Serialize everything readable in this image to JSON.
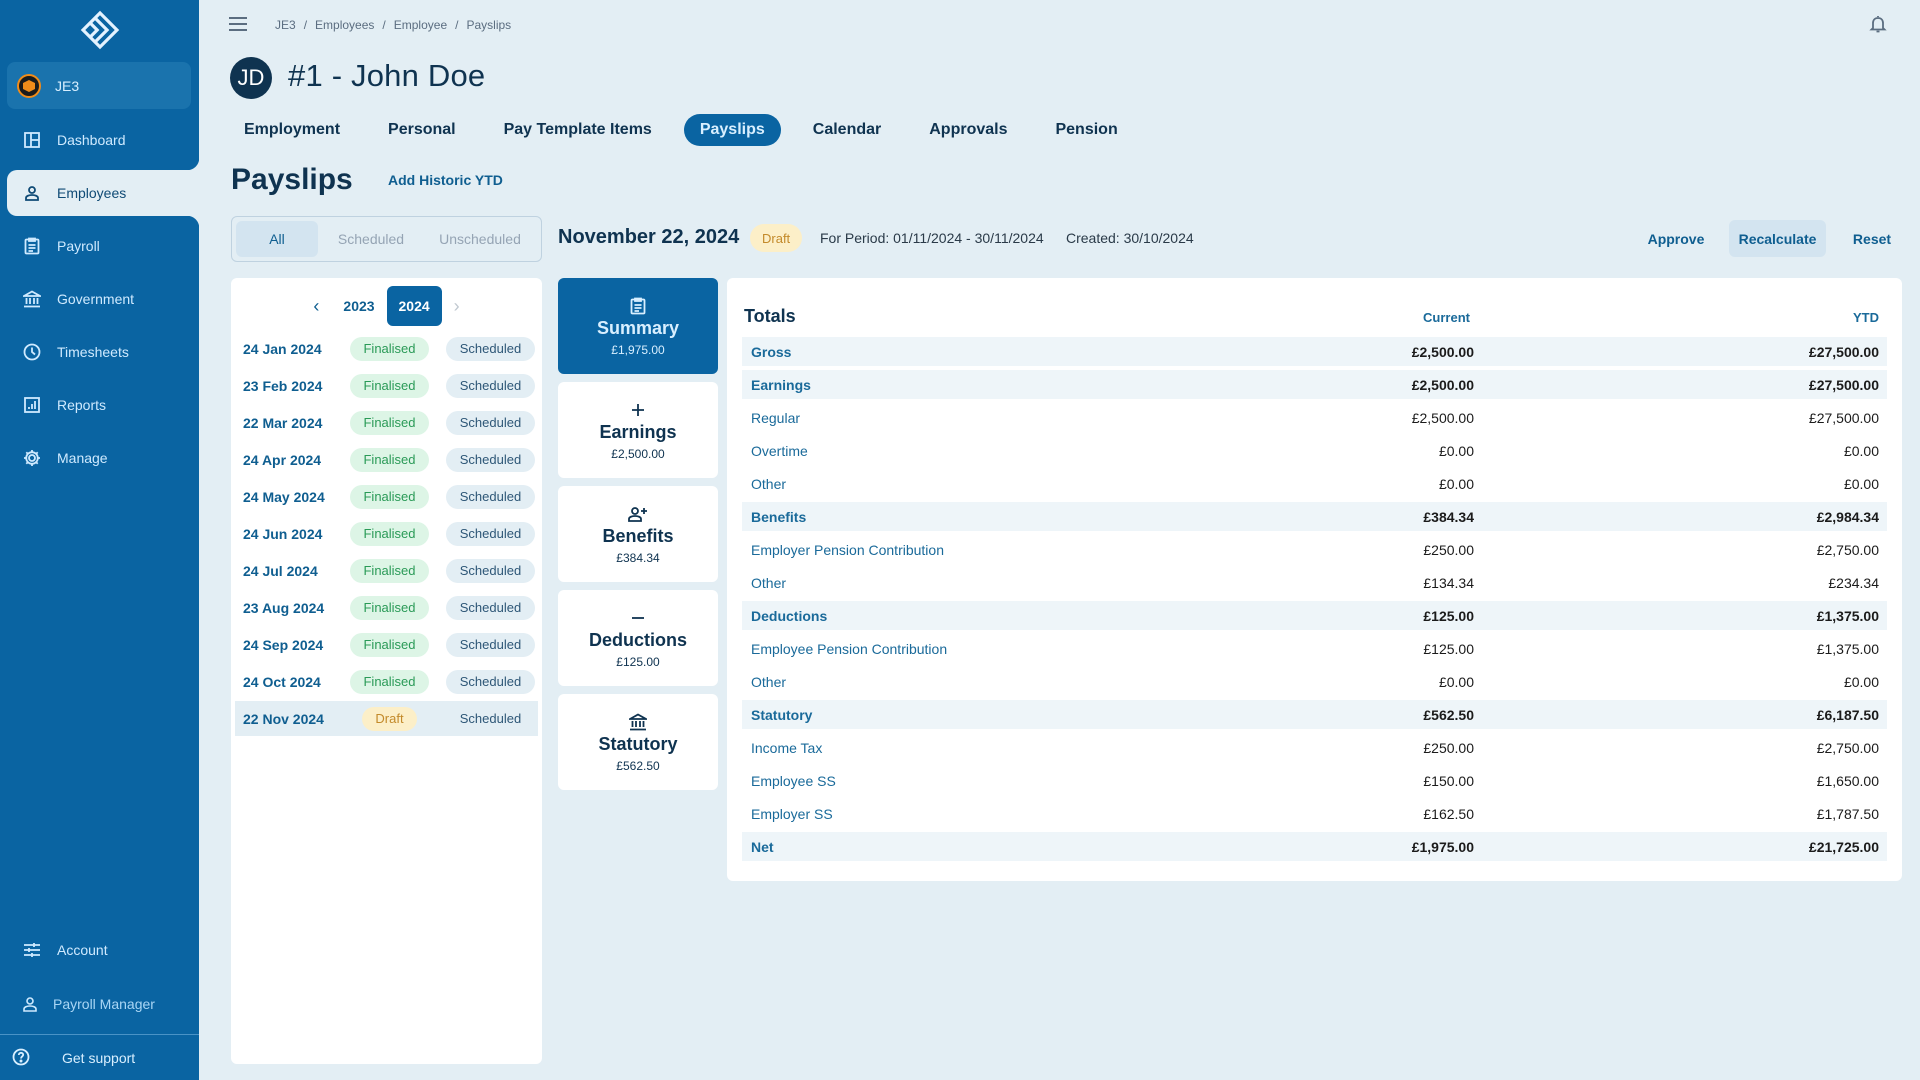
{
  "sidebar": {
    "org": "JE3",
    "items": [
      {
        "label": "Dashboard",
        "icon": "dashboard-icon"
      },
      {
        "label": "Employees",
        "icon": "person-icon",
        "active": true
      },
      {
        "label": "Payroll",
        "icon": "clipboard-icon"
      },
      {
        "label": "Government",
        "icon": "bank-icon"
      },
      {
        "label": "Timesheets",
        "icon": "clock-icon"
      },
      {
        "label": "Reports",
        "icon": "chart-icon"
      },
      {
        "label": "Manage",
        "icon": "gear-icon"
      }
    ],
    "account": "Account",
    "user_role": "Payroll Manager",
    "support": "Get support"
  },
  "breadcrumb": [
    "JE3",
    "/",
    "Employees",
    "/",
    "Employee",
    "/",
    "Payslips"
  ],
  "employee": {
    "initials": "JD",
    "title": "#1 -  John Doe"
  },
  "tabs": [
    {
      "label": "Employment"
    },
    {
      "label": "Personal"
    },
    {
      "label": "Pay Template Items"
    },
    {
      "label": "Payslips",
      "active": true
    },
    {
      "label": "Calendar"
    },
    {
      "label": "Approvals"
    },
    {
      "label": "Pension"
    }
  ],
  "page": {
    "title": "Payslips",
    "add_ytd": "Add Historic YTD"
  },
  "filter": {
    "options": [
      "All",
      "Scheduled",
      "Unscheduled"
    ],
    "selected": "All"
  },
  "payslip": {
    "date": "November 22, 2024",
    "status": "Draft",
    "period": "For Period: 01/11/2024 - 30/11/2024",
    "created": "Created: 30/10/2024"
  },
  "actions": {
    "approve": "Approve",
    "recalculate": "Recalculate",
    "reset": "Reset"
  },
  "years": {
    "prev": "2023",
    "current": "2024"
  },
  "slips": [
    {
      "date": "24 Jan 2024",
      "status": "Finalised",
      "type": "Scheduled"
    },
    {
      "date": "23 Feb 2024",
      "status": "Finalised",
      "type": "Scheduled"
    },
    {
      "date": "22 Mar 2024",
      "status": "Finalised",
      "type": "Scheduled"
    },
    {
      "date": "24 Apr 2024",
      "status": "Finalised",
      "type": "Scheduled"
    },
    {
      "date": "24 May 2024",
      "status": "Finalised",
      "type": "Scheduled"
    },
    {
      "date": "24 Jun 2024",
      "status": "Finalised",
      "type": "Scheduled"
    },
    {
      "date": "24 Jul 2024",
      "status": "Finalised",
      "type": "Scheduled"
    },
    {
      "date": "23 Aug 2024",
      "status": "Finalised",
      "type": "Scheduled"
    },
    {
      "date": "24 Sep 2024",
      "status": "Finalised",
      "type": "Scheduled"
    },
    {
      "date": "24 Oct 2024",
      "status": "Finalised",
      "type": "Scheduled"
    },
    {
      "date": "22 Nov 2024",
      "status": "Draft",
      "type": "Scheduled",
      "active": true
    }
  ],
  "cards": [
    {
      "title": "Summary",
      "value": "£1,975.00",
      "icon": "clipboard-icon",
      "active": true
    },
    {
      "title": "Earnings",
      "value": "£2,500.00",
      "icon": "plus-icon"
    },
    {
      "title": "Benefits",
      "value": "£384.34",
      "icon": "person-add-icon"
    },
    {
      "title": "Deductions",
      "value": "£125.00",
      "icon": "minus-icon"
    },
    {
      "title": "Statutory",
      "value": "£562.50",
      "icon": "bank-icon"
    }
  ],
  "totals": {
    "heading": "Totals",
    "col_current": "Current",
    "col_ytd": "YTD",
    "rows": [
      {
        "label": "Gross",
        "current": "£2,500.00",
        "ytd": "£27,500.00",
        "bold": true
      },
      {
        "label": "Earnings",
        "current": "£2,500.00",
        "ytd": "£27,500.00",
        "bold": true
      },
      {
        "label": "Regular",
        "current": "£2,500.00",
        "ytd": "£27,500.00"
      },
      {
        "label": "Overtime",
        "current": "£0.00",
        "ytd": "£0.00"
      },
      {
        "label": "Other",
        "current": "£0.00",
        "ytd": "£0.00"
      },
      {
        "label": "Benefits",
        "current": "£384.34",
        "ytd": "£2,984.34",
        "bold": true
      },
      {
        "label": "Employer Pension Contribution",
        "current": "£250.00",
        "ytd": "£2,750.00"
      },
      {
        "label": "Other",
        "current": "£134.34",
        "ytd": "£234.34"
      },
      {
        "label": "Deductions",
        "current": "£125.00",
        "ytd": "£1,375.00",
        "bold": true
      },
      {
        "label": "Employee Pension Contribution",
        "current": "£125.00",
        "ytd": "£1,375.00"
      },
      {
        "label": "Other",
        "current": "£0.00",
        "ytd": "£0.00"
      },
      {
        "label": "Statutory",
        "current": "£562.50",
        "ytd": "£6,187.50",
        "bold": true
      },
      {
        "label": "Income Tax",
        "current": "£250.00",
        "ytd": "£2,750.00"
      },
      {
        "label": "Employee SS",
        "current": "£150.00",
        "ytd": "£1,650.00"
      },
      {
        "label": "Employer SS",
        "current": "£162.50",
        "ytd": "£1,787.50"
      },
      {
        "label": "Net",
        "current": "£1,975.00",
        "ytd": "£21,725.00",
        "bold": true
      }
    ]
  },
  "colors": {
    "sidebar": "#0a64a2",
    "background": "#e3eef4",
    "primary": "#0a64a2",
    "finalised": "#2a9a57",
    "draft": "#c38a2a"
  }
}
